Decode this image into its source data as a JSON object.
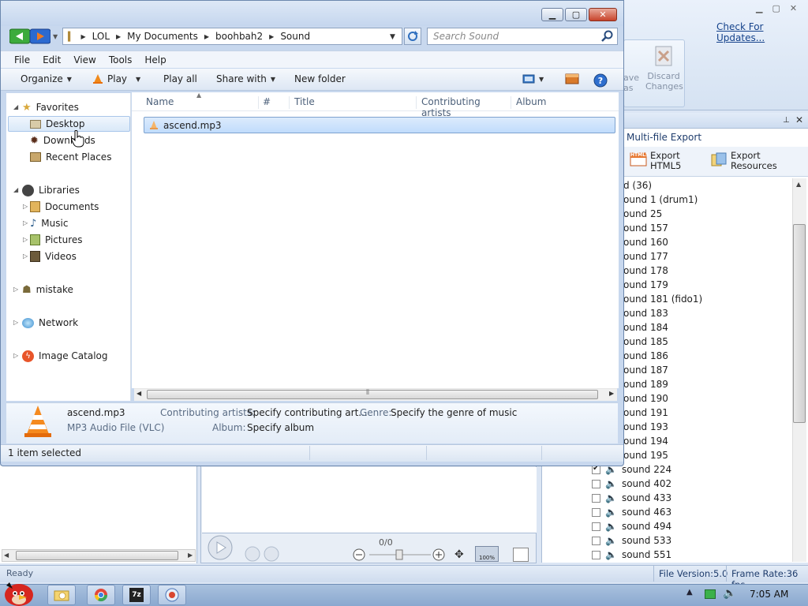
{
  "background_app": {
    "check_updates": "Check For Updates...",
    "ribbon_save_partial": "ave\nas",
    "ribbon_discard": "Discard\nChanges",
    "panel_title_partial": "Multi-file Export",
    "export_html5": "Export\nHTML5",
    "export_html5_badge": "HTML5",
    "export_resources": "Export\nResources",
    "tree_items": [
      {
        "label": "d (36)"
      },
      {
        "label": "ound 1 (drum1)"
      },
      {
        "label": "ound 25"
      },
      {
        "label": "ound 157"
      },
      {
        "label": "ound 160"
      },
      {
        "label": "ound 177"
      },
      {
        "label": "ound 178"
      },
      {
        "label": "ound 179"
      },
      {
        "label": "ound 181 (fido1)"
      },
      {
        "label": "ound 183"
      },
      {
        "label": "ound 184"
      },
      {
        "label": "ound 185"
      },
      {
        "label": "ound 186"
      },
      {
        "label": "ound 187"
      },
      {
        "label": "ound 189"
      },
      {
        "label": "ound 190"
      },
      {
        "label": "ound 191"
      },
      {
        "label": "ound 193"
      },
      {
        "label": "ound 194"
      },
      {
        "label": "ound 195"
      },
      {
        "label": "sound 224",
        "checked": true
      },
      {
        "label": "sound 402",
        "checked": false
      },
      {
        "label": "sound 433",
        "checked": false
      },
      {
        "label": "sound 463",
        "checked": false
      },
      {
        "label": "sound 494",
        "checked": false
      },
      {
        "label": "sound 533",
        "checked": false
      },
      {
        "label": "sound 551",
        "checked": false
      }
    ],
    "player_counter": "0/0",
    "status_ready": "Ready",
    "file_version": "File Version:5.0",
    "frame_rate": "Frame Rate:36 fps"
  },
  "taskbar": {
    "clock": "7:05 AM",
    "icons": [
      "angry-bird-start",
      "folder-icon",
      "chrome-icon",
      "7zip-icon",
      "ffdec-icon"
    ]
  },
  "explorer": {
    "breadcrumbs": [
      "LOL",
      "My Documents",
      "boohbah2",
      "Sound"
    ],
    "search_placeholder": "Search Sound",
    "menu": [
      "File",
      "Edit",
      "View",
      "Tools",
      "Help"
    ],
    "toolbar": {
      "organize": "Organize",
      "play": "Play",
      "play_all": "Play all",
      "share_with": "Share with",
      "new_folder": "New folder"
    },
    "nav": {
      "favorites": "Favorites",
      "desktop": "Desktop",
      "downloads": "Downloads",
      "recent_places": "Recent Places",
      "libraries": "Libraries",
      "documents": "Documents",
      "music": "Music",
      "pictures": "Pictures",
      "videos": "Videos",
      "mistake": "mistake",
      "network": "Network",
      "image_catalog": "Image Catalog"
    },
    "columns": [
      "Name",
      "#",
      "Title",
      "Contributing artists",
      "Album"
    ],
    "files": [
      {
        "name": "ascend.mp3"
      }
    ],
    "details": {
      "filename": "ascend.mp3",
      "filetype": "MP3 Audio File (VLC)",
      "contrib_label": "Contributing artists:",
      "contrib_value": "Specify contributing art...",
      "genre_label": "Genre:",
      "genre_value": "Specify the genre of music",
      "album_label": "Album:",
      "album_value": "Specify album"
    },
    "status": "1 item selected"
  },
  "colors": {
    "accent": "#3a6ea5",
    "selection": "#c1dcfc",
    "vlc_orange": "#f08a1c"
  }
}
